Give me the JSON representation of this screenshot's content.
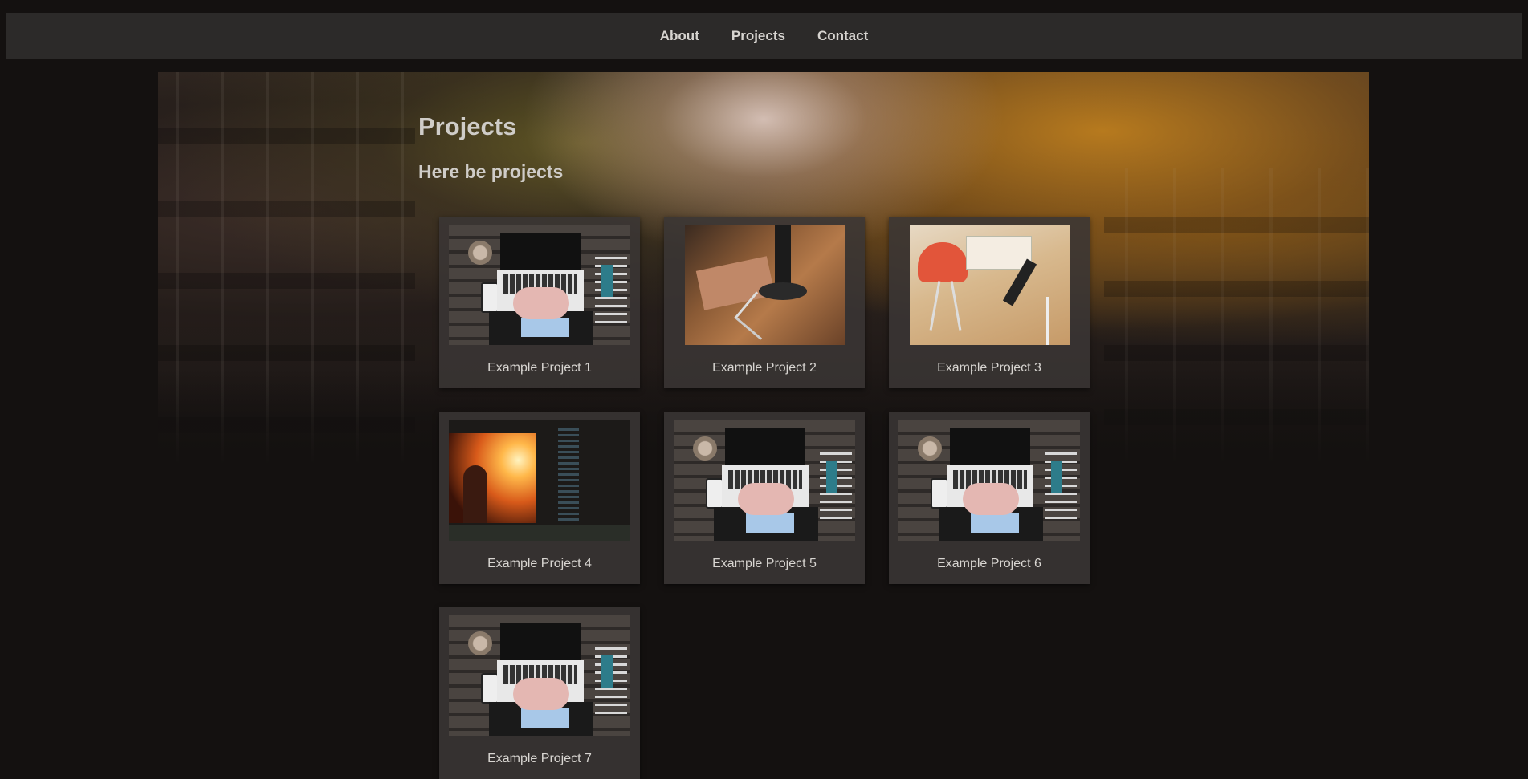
{
  "nav": {
    "items": [
      {
        "label": "About"
      },
      {
        "label": "Projects"
      },
      {
        "label": "Contact"
      }
    ]
  },
  "header": {
    "title": "Projects",
    "subtitle": "Here be projects"
  },
  "projects": [
    {
      "label": "Example Project 1",
      "image": "laptop-photo"
    },
    {
      "label": "Example Project 2",
      "image": "desk-photo"
    },
    {
      "label": "Example Project 3",
      "image": "office-photo"
    },
    {
      "label": "Example Project 4",
      "image": "sunset-photo"
    },
    {
      "label": "Example Project 5",
      "image": "laptop-photo"
    },
    {
      "label": "Example Project 6",
      "image": "laptop-photo"
    },
    {
      "label": "Example Project 7",
      "image": "laptop-photo"
    }
  ]
}
